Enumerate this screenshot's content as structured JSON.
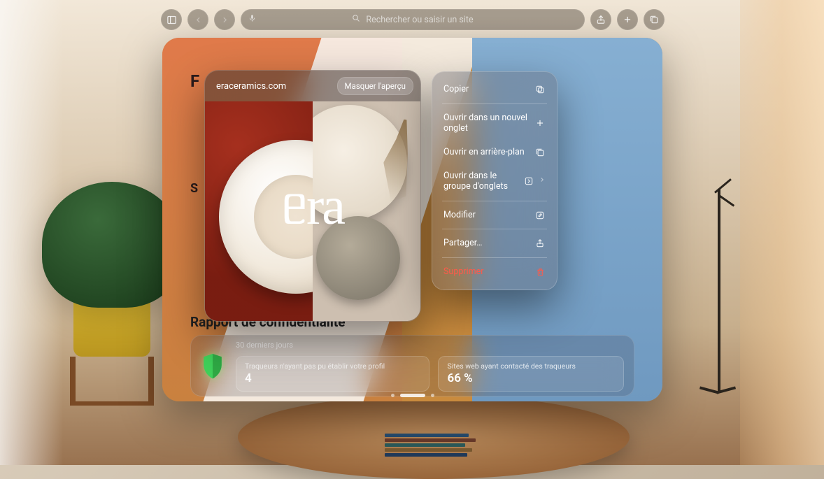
{
  "toolbar": {
    "search_placeholder": "Rechercher ou saisir un site"
  },
  "start_page": {
    "heading_first_letter": "F",
    "subheading_first_letter": "S",
    "privacy_heading": "Rapport de confidentialité",
    "privacy_period": "30 derniers jours",
    "metrics": {
      "trackers_blocked": {
        "label": "Traqueurs n'ayant pas pu établir votre profil",
        "value": "4"
      },
      "sites_contacted": {
        "label": "Sites web ayant contacté des traqueurs",
        "value": "66 %"
      }
    }
  },
  "preview": {
    "domain": "eraceramics.com",
    "hide_label": "Masquer l'aperçu",
    "logo_text": "ᥱra"
  },
  "context_menu": {
    "copy": "Copier",
    "open_new_tab": "Ouvrir dans un nouvel onglet",
    "open_background": "Ouvrir en arrière-plan",
    "open_tab_group": "Ouvrir dans le groupe d'onglets",
    "edit": "Modifier",
    "share": "Partager…",
    "delete": "Supprimer"
  }
}
